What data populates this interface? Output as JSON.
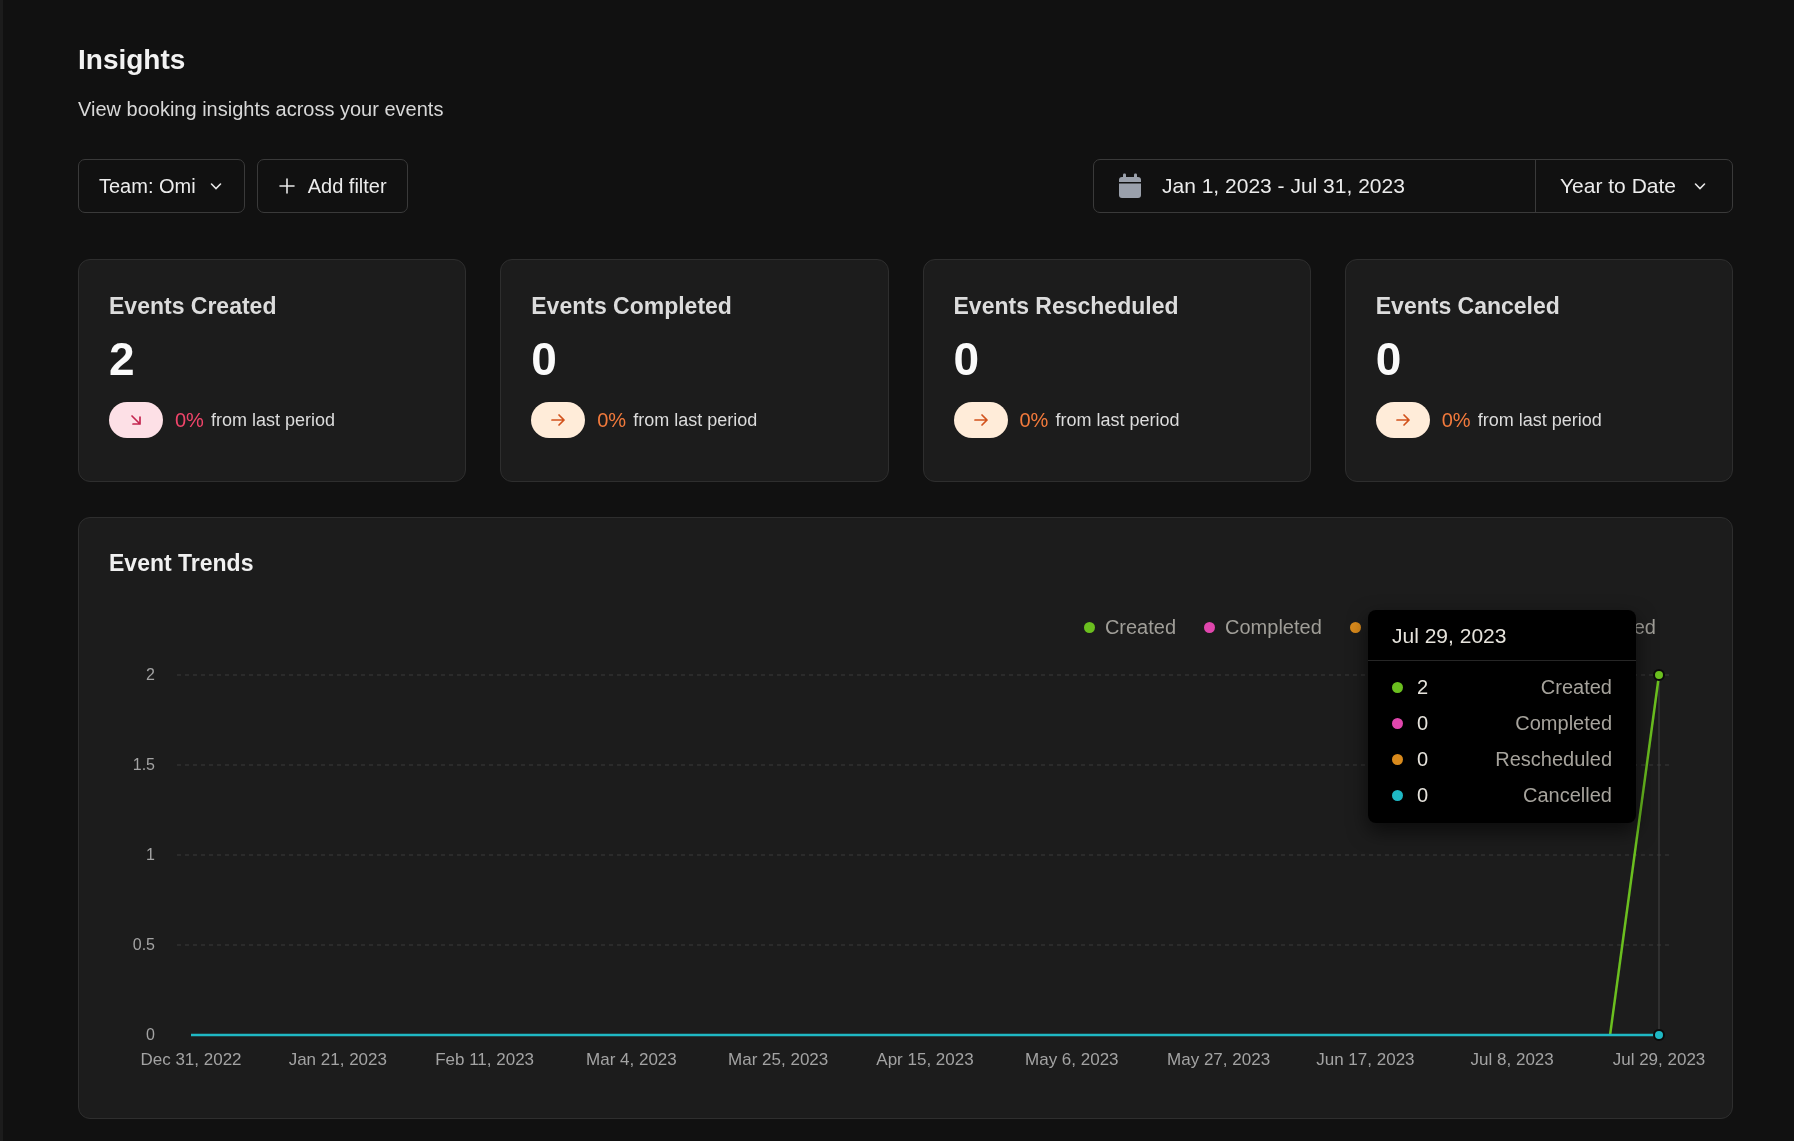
{
  "header": {
    "title": "Insights",
    "subtitle": "View booking insights across your events"
  },
  "filters": {
    "team": "Team: Omi",
    "add_filter": "Add filter"
  },
  "date_range": {
    "range": "Jan 1, 2023 - Jul 31, 2023",
    "preset": "Year to Date"
  },
  "stats": [
    {
      "title": "Events Created",
      "value": "2",
      "kind": "down",
      "percent": "0%",
      "caption": "from last period"
    },
    {
      "title": "Events Completed",
      "value": "0",
      "kind": "flat",
      "percent": "0%",
      "caption": "from last period"
    },
    {
      "title": "Events Rescheduled",
      "value": "0",
      "kind": "flat",
      "percent": "0%",
      "caption": "from last period"
    },
    {
      "title": "Events Canceled",
      "value": "0",
      "kind": "flat",
      "percent": "0%",
      "caption": "from last period"
    }
  ],
  "trends": {
    "title": "Event Trends",
    "legend": [
      {
        "label": "Created",
        "color": "#6bbf1f"
      },
      {
        "label": "Completed",
        "color": "#e046ad"
      },
      {
        "color": "#d98a1c"
      },
      {
        "label": "ed"
      }
    ],
    "tooltip": {
      "date": "Jul 29, 2023",
      "rows": [
        {
          "value": "2"
        },
        {
          "value": "0"
        },
        {
          "value": "0"
        },
        {
          "value": "0"
        }
      ]
    },
    "chart_data": {
      "type": "line",
      "categories": [
        "Dec 31, 2022",
        null,
        null,
        "Jan 21, 2023",
        null,
        null,
        "Feb 11, 2023",
        null,
        null,
        "Mar 4, 2023",
        null,
        null,
        "Mar 25, 2023",
        null,
        null,
        "Apr 15, 2023",
        null,
        null,
        "May 6, 2023",
        null,
        null,
        "May 27, 2023",
        null,
        null,
        "Jun 17, 2023",
        null,
        null,
        "Jul 8, 2023",
        null,
        null,
        "Jul 29, 2023"
      ],
      "series": [
        {
          "name": "Created",
          "color": "#6bbf1f",
          "values": [
            null,
            null,
            null,
            null,
            null,
            null,
            null,
            null,
            null,
            null,
            null,
            null,
            null,
            null,
            null,
            null,
            null,
            null,
            null,
            null,
            null,
            null,
            null,
            null,
            null,
            null,
            null,
            null,
            null,
            0,
            2
          ]
        },
        {
          "name": "Completed",
          "color": "#e046ad",
          "values": [
            null,
            null,
            null,
            null,
            null,
            null,
            null,
            null,
            null,
            null,
            null,
            null,
            null,
            null,
            null,
            null,
            null,
            null,
            null,
            null,
            null,
            null,
            null,
            null,
            null,
            null,
            null,
            null,
            null,
            null,
            null
          ]
        },
        {
          "name": "Rescheduled",
          "color": "#d98a1c",
          "values": [
            null,
            null,
            null,
            null,
            null,
            null,
            null,
            null,
            null,
            null,
            null,
            null,
            null,
            null,
            null,
            null,
            null,
            null,
            null,
            null,
            null,
            null,
            null,
            null,
            null,
            null,
            null,
            null,
            null,
            null,
            null
          ]
        },
        {
          "name": "Cancelled",
          "color": "#1fb8c4",
          "values": [
            0,
            0,
            0,
            0,
            0,
            0,
            0,
            0,
            0,
            0,
            0,
            0,
            0,
            0,
            0,
            0,
            0,
            0,
            0,
            0,
            0,
            0,
            0,
            0,
            0,
            0,
            0,
            0,
            0,
            0,
            0
          ]
        }
      ],
      "ylim": [
        0,
        2
      ],
      "grid": true,
      "yticks": [
        0,
        {
          "value": 0.5,
          "label": "0.5"
        },
        {
          "value": 1,
          "label": "1"
        },
        {
          "value": 1.5,
          "label": "1.5"
        },
        {
          "value": 2,
          "label": "2"
        }
      ]
    }
  }
}
